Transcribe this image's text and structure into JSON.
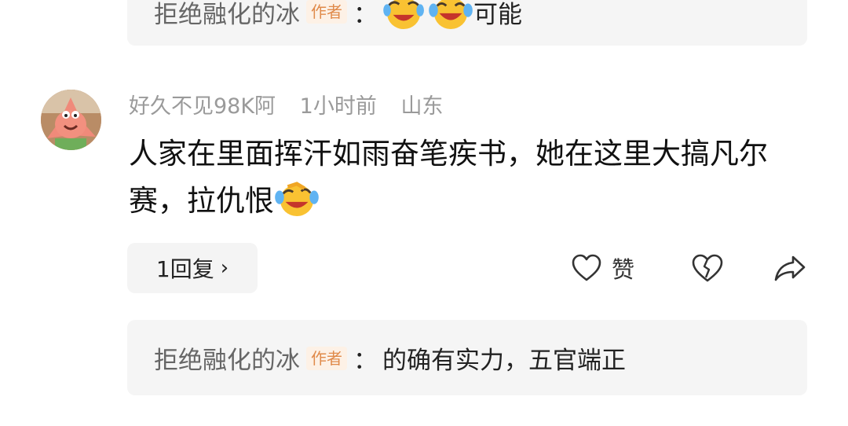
{
  "top_reply": {
    "name": "拒绝融化的冰",
    "author_tag": "作者",
    "separator": "：",
    "text": "可能"
  },
  "comment": {
    "username": "好久不见98K阿",
    "time": "1小时前",
    "location": "山东",
    "text": "人家在里面挥汗如雨奋笔疾书，她在这里大搞凡尔赛，拉仇恨"
  },
  "replies_button": {
    "label": "1回复",
    "chevron": "›"
  },
  "actions": {
    "like_label": "赞"
  },
  "bottom_reply": {
    "name": "拒绝融化的冰",
    "author_tag": "作者",
    "separator": "：",
    "text": "的确有实力，五官端正"
  },
  "icons": {
    "avatar": "patrick-star-avatar",
    "emoji": "laughing-crying-emoji",
    "like": "heart-outline-icon",
    "dislike": "broken-heart-icon",
    "share": "share-arrow-icon"
  }
}
